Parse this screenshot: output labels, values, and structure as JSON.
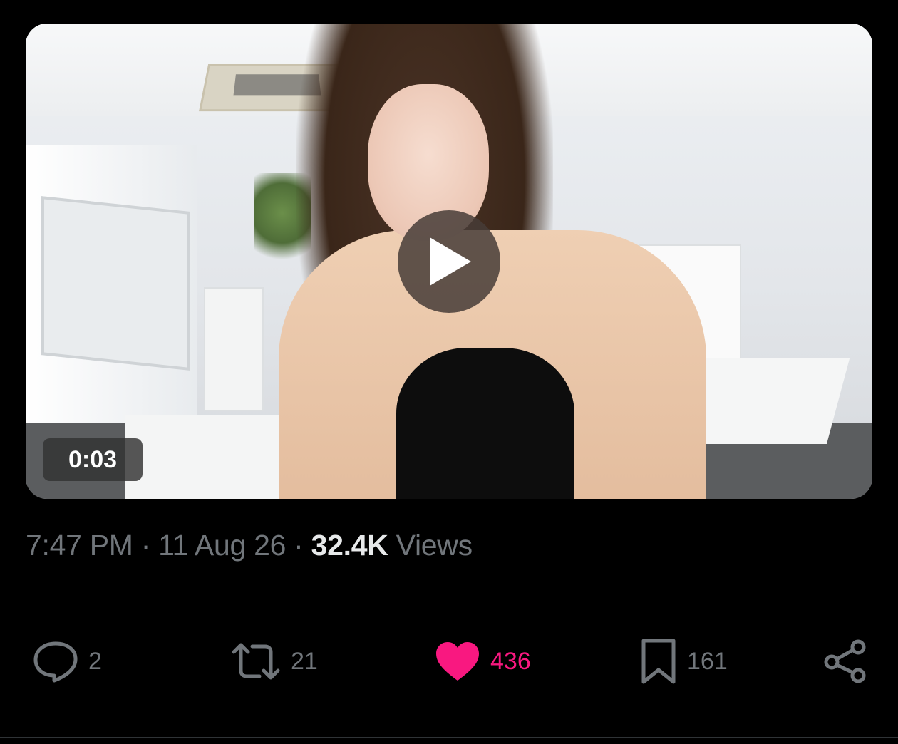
{
  "video": {
    "duration": "0:03",
    "play_icon": "play-icon"
  },
  "meta": {
    "time": "7:47 PM",
    "sep1": "·",
    "date": "11 Aug 26",
    "sep2": "·",
    "views_count": "32.4K",
    "views_label": "Views"
  },
  "actions": {
    "replies": {
      "icon": "reply-icon",
      "count": "2"
    },
    "reposts": {
      "icon": "repost-icon",
      "count": "21"
    },
    "likes": {
      "icon": "heart-icon",
      "count": "436",
      "color": "#f91880",
      "liked": true
    },
    "bookmarks": {
      "icon": "bookmark-icon",
      "count": "161"
    },
    "share": {
      "icon": "share-icon"
    }
  },
  "colors": {
    "background": "#000000",
    "secondary_text": "#71767b",
    "primary_text": "#e7e9ea",
    "like": "#f91880"
  }
}
